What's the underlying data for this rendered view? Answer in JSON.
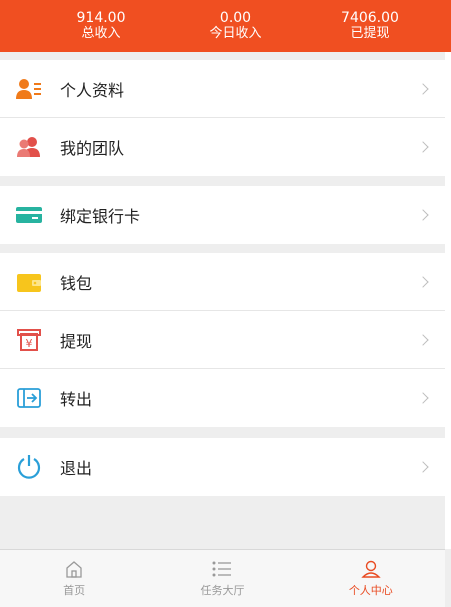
{
  "stats": [
    {
      "value": "914.00",
      "label": "总收入"
    },
    {
      "value": "0.00",
      "label": "今日收入"
    },
    {
      "value": "7406.00",
      "label": "已提现"
    }
  ],
  "menu": {
    "group1": [
      {
        "label": "个人资料",
        "icon": "profile-icon"
      },
      {
        "label": "我的团队",
        "icon": "team-icon"
      }
    ],
    "group2": [
      {
        "label": "绑定银行卡",
        "icon": "bank-card-icon"
      }
    ],
    "group3": [
      {
        "label": "钱包",
        "icon": "wallet-icon"
      },
      {
        "label": "提现",
        "icon": "withdraw-icon"
      },
      {
        "label": "转出",
        "icon": "transfer-out-icon"
      }
    ],
    "group4": [
      {
        "label": "退出",
        "icon": "power-icon"
      }
    ]
  },
  "tabbar": [
    {
      "label": "首页",
      "icon": "home-icon",
      "active": false
    },
    {
      "label": "任务大厅",
      "icon": "list-icon",
      "active": false
    },
    {
      "label": "个人中心",
      "icon": "user-icon",
      "active": true
    }
  ],
  "colors": {
    "accent": "#f04f21",
    "active_tab": "#e94b22",
    "icon_orange": "#f07a1a",
    "icon_red": "#e2504a",
    "icon_teal": "#27b3a0",
    "icon_yellow": "#f7c51c",
    "icon_blue": "#2a9fd8"
  }
}
